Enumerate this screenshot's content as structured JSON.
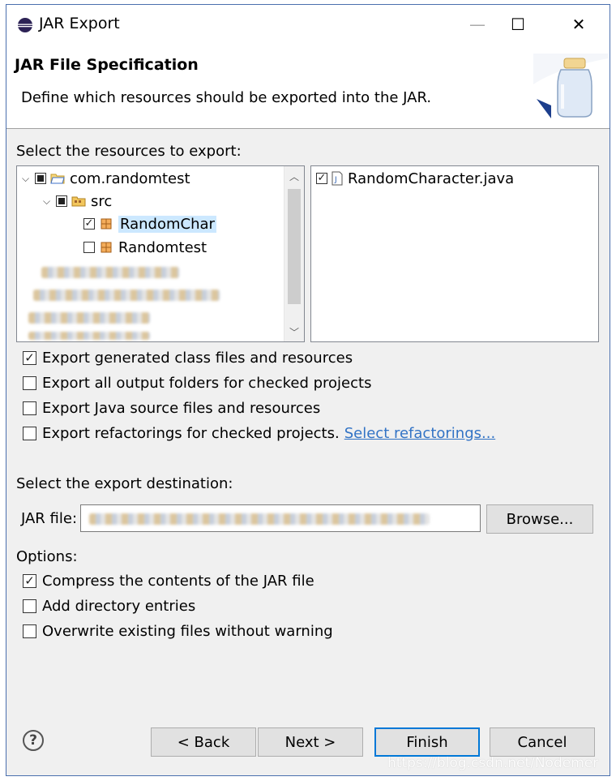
{
  "window": {
    "title": "JAR Export",
    "minimize_label": "—",
    "maximize_label": "☐",
    "close_label": "✕"
  },
  "header": {
    "title": "JAR File Specification",
    "description": "Define which resources should be exported into the JAR."
  },
  "resources": {
    "label": "Select the resources to export:",
    "tree": [
      {
        "label": "com.randomtest",
        "state": "partial",
        "expanded": true
      },
      {
        "label": "src",
        "state": "partial",
        "expanded": true
      },
      {
        "label": "RandomChar",
        "state": "checked",
        "selected": true
      },
      {
        "label": "Randomtest",
        "state": "unchecked"
      }
    ],
    "files": [
      {
        "label": "RandomCharacter.java",
        "state": "checked"
      }
    ]
  },
  "export_options": [
    {
      "label": "Export generated class files and resources",
      "checked": true
    },
    {
      "label": "Export all output folders for checked projects",
      "checked": false
    },
    {
      "label": "Export Java source files and resources",
      "checked": false
    },
    {
      "label": "Export refactorings for checked projects.",
      "checked": false,
      "link": "Select refactorings..."
    }
  ],
  "destination": {
    "label": "Select the export destination:",
    "jar_file_label": "JAR file:",
    "browse_label": "Browse..."
  },
  "options": {
    "label": "Options:",
    "items": [
      {
        "label": "Compress the contents of the JAR file",
        "checked": true
      },
      {
        "label": "Add directory entries",
        "checked": false
      },
      {
        "label": "Overwrite existing files without warning",
        "checked": false
      }
    ]
  },
  "footer": {
    "help_label": "?",
    "back_label": "< Back",
    "next_label": "Next >",
    "finish_label": "Finish",
    "cancel_label": "Cancel",
    "watermark": "https://blog.csdn.net/Nodemer"
  }
}
